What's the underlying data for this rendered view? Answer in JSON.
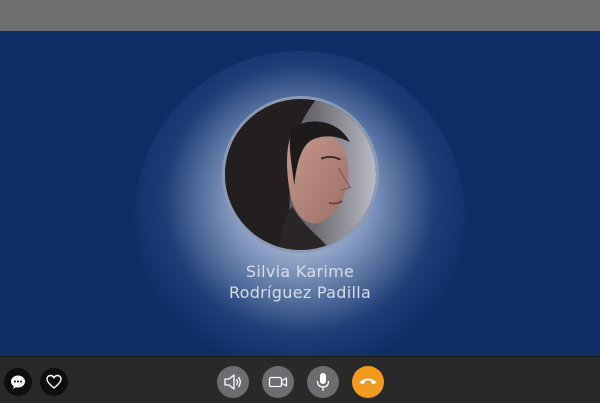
{
  "call": {
    "caller_name_line1": "Silvia Karime",
    "caller_name_line2": "Rodríguez Padilla"
  },
  "controls": {
    "left": [
      {
        "name": "chat-button",
        "icon": "chat-bubble-icon"
      },
      {
        "name": "favorite-button",
        "icon": "heart-icon"
      }
    ],
    "center": [
      {
        "name": "speaker-button",
        "icon": "speaker-icon"
      },
      {
        "name": "video-button",
        "icon": "video-camera-icon"
      },
      {
        "name": "microphone-button",
        "icon": "microphone-icon"
      },
      {
        "name": "end-call-button",
        "icon": "hang-up-icon"
      }
    ]
  },
  "colors": {
    "stage_background": "#0d2e63",
    "top_bar": "#6e6f71",
    "bottom_bar": "#2a2929",
    "control_button": "#6b6d70",
    "end_call": "#f39a1e"
  }
}
